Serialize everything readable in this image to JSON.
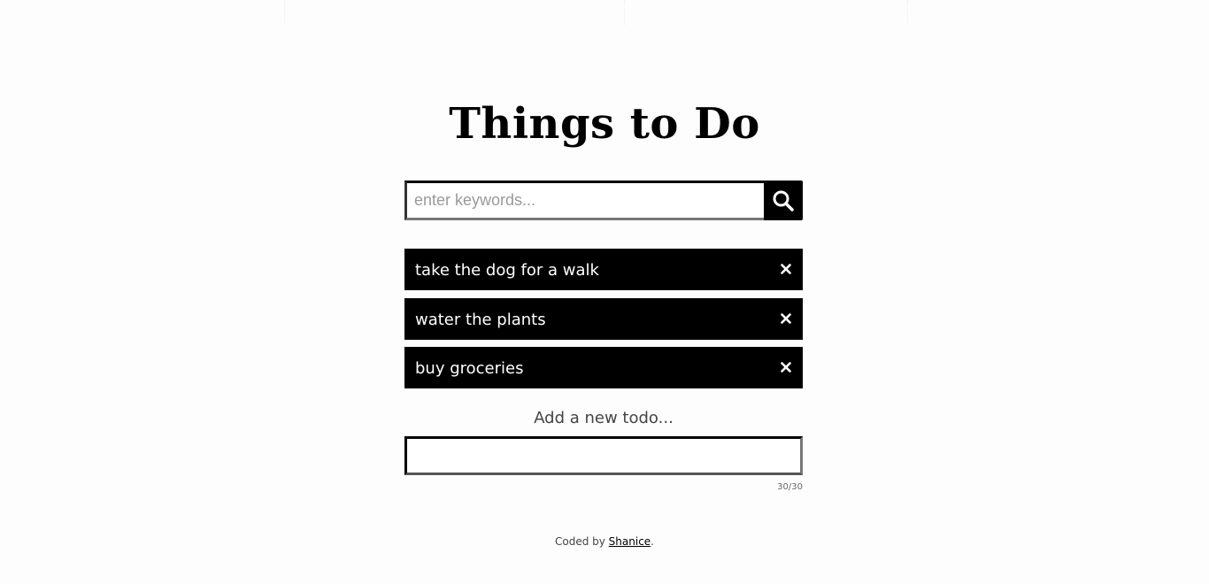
{
  "header": {
    "title": "Things to Do"
  },
  "search": {
    "placeholder": "enter keywords...",
    "button_icon": "search-icon"
  },
  "todos": {
    "items": [
      {
        "text": "take the dog for a walk"
      },
      {
        "text": "water the plants"
      },
      {
        "text": "buy groceries"
      }
    ],
    "delete_icon": "close-icon"
  },
  "add_todo": {
    "label": "Add a new todo...",
    "value": "",
    "char_count": "30/30"
  },
  "footer": {
    "prefix": "Coded by ",
    "author": "Shanice",
    "suffix": "."
  },
  "colors": {
    "item_background": "#000000",
    "item_text": "#ffffff",
    "page_background": "#fdfdfd"
  }
}
